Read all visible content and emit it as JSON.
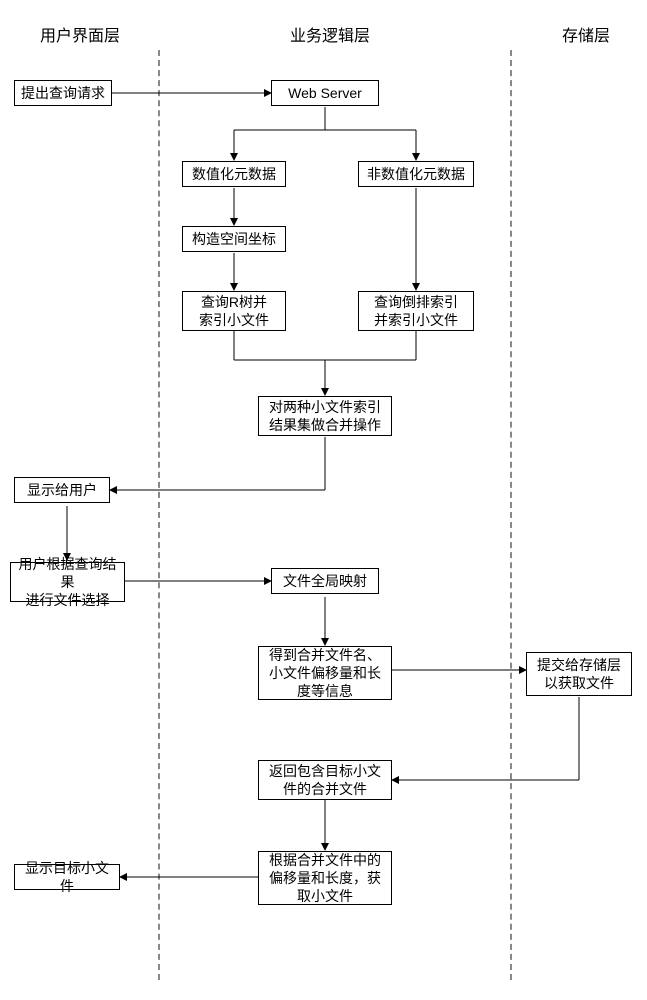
{
  "lanes": {
    "ui": "用户界面层",
    "logic": "业务逻辑层",
    "storage": "存储层"
  },
  "nodes": {
    "submit_query": "提出查询请求",
    "web_server": "Web Server",
    "numeric_meta": "数值化元数据",
    "nonnumeric_meta": "非数值化元数据",
    "build_coords": "构造空间坐标",
    "rtree_index": "查询R树并\n索引小文件",
    "inverted_index": "查询倒排索引\n并索引小文件",
    "merge_results": "对两种小文件索引\n结果集做合并操作",
    "show_user": "显示给用户",
    "user_select": "用户根据查询结果\n进行文件选择",
    "global_map": "文件全局映射",
    "get_info": "得到合并文件名、\n小文件偏移量和长\n度等信息",
    "submit_storage": "提交给存储层\n以获取文件",
    "return_merged": "返回包含目标小文\n件的合并文件",
    "extract_small": "根据合并文件中的\n偏移量和长度，获\n取小文件",
    "show_target": "显示目标小文件"
  }
}
